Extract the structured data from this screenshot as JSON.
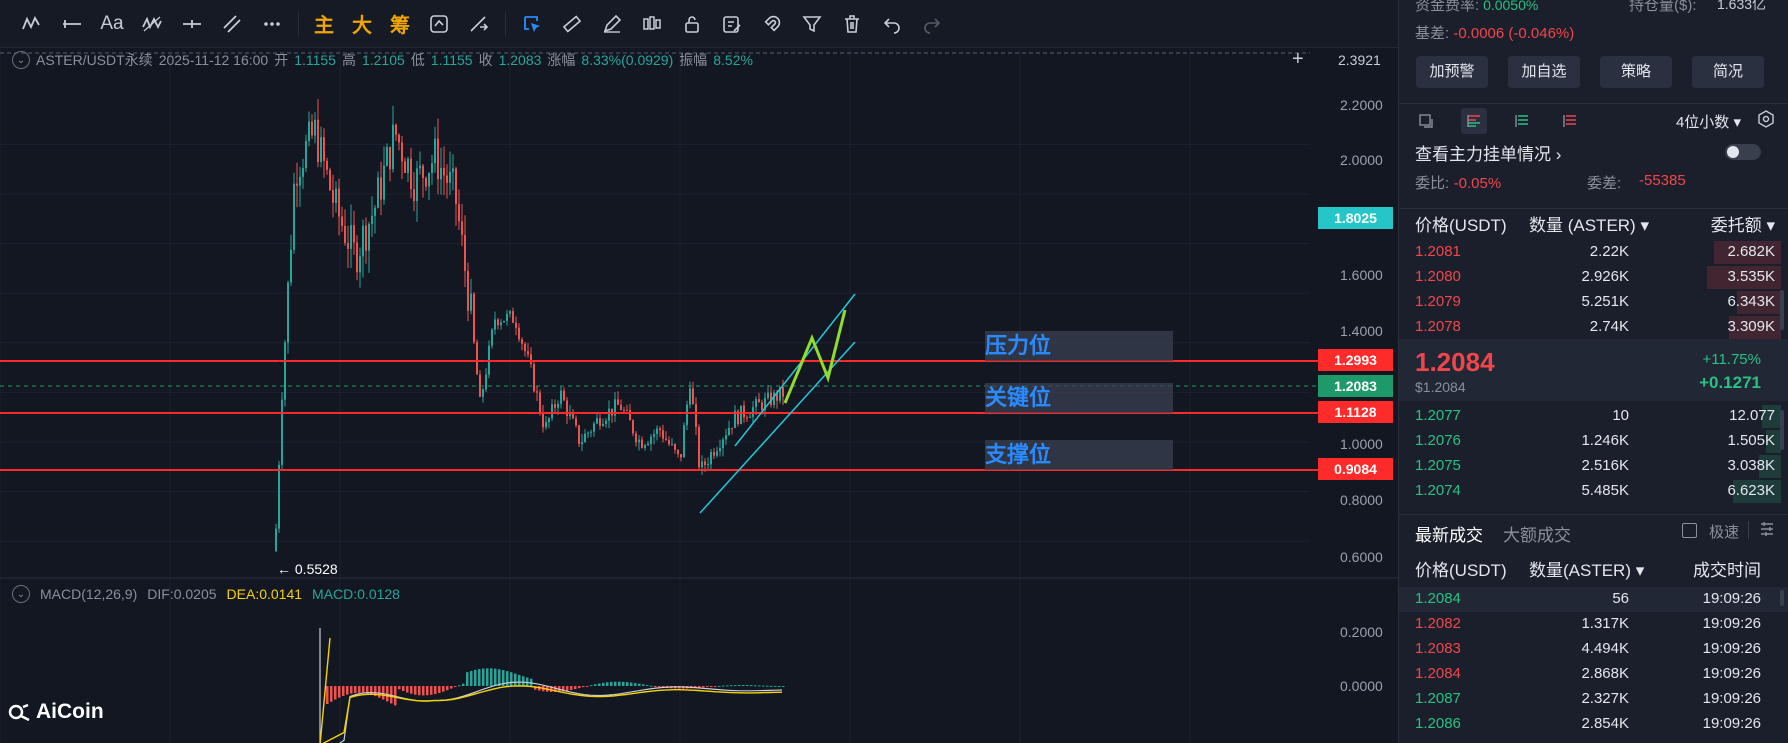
{
  "toolbar": {
    "text_items": [
      "主",
      "大",
      "筹"
    ],
    "font_label": "Aa"
  },
  "legend": {
    "pair": "ASTER/USDT永续",
    "time": "2025-11-12 16:00",
    "open_label": "开",
    "open": "1.1155",
    "high_label": "高",
    "high": "1.2105",
    "low_label": "低",
    "low": "1.1155",
    "close_label": "收",
    "close": "1.2083",
    "change_label": "涨幅",
    "change": "8.33%(0.0929)",
    "amp_label": "振幅",
    "amp": "8.52%"
  },
  "macd_legend": {
    "name": "MACD(12,26,9)",
    "dif": "DIF:0.0205",
    "dea": "DEA:0.0141",
    "macd": "MACD:0.0128"
  },
  "zones": {
    "resistance": "压力位",
    "key": "关键位",
    "support": "支撑位"
  },
  "price_tags": {
    "top": "2.3921",
    "highlight": "1.8025",
    "resistance": "1.2993",
    "current": "1.2083",
    "key": "1.1128",
    "support": "0.9084"
  },
  "axis_labels": [
    "2.2000",
    "2.0000",
    "1.6000",
    "1.4000",
    "1.0000",
    "0.8000",
    "0.6000"
  ],
  "macd_axis": [
    "0.2000",
    "0.0000"
  ],
  "low_marker": "0.5528",
  "logo": "AiCoin",
  "panel": {
    "funding_label": "资金费率:",
    "funding_value": "0.0050%",
    "oi_label": "持仓量($):",
    "oi_value": "1.633亿",
    "basis_label": "基差:",
    "basis_value": "-0.0006 (-0.046%)",
    "buttons": [
      "加预警",
      "加自选",
      "策略",
      "简况"
    ],
    "precision": "4位小数",
    "main_orders": "查看主力挂单情况",
    "ratio_label": "委比:",
    "ratio_value": "-0.05%",
    "diff_label": "委差:",
    "diff_value": "-55385",
    "ob_headers": [
      "价格(USDT)",
      "数量 (ASTER)",
      "委托额"
    ],
    "asks": [
      {
        "price": "1.2081",
        "qty": "2.22K",
        "amount": "2.682K",
        "depth": 0.18
      },
      {
        "price": "1.2080",
        "qty": "2.926K",
        "amount": "3.535K",
        "depth": 0.2
      },
      {
        "price": "1.2079",
        "qty": "5.251K",
        "amount": "6.343K",
        "depth": 0.12
      },
      {
        "price": "1.2078",
        "qty": "2.74K",
        "amount": "3.309K",
        "depth": 0.14
      }
    ],
    "last_price": "1.2084",
    "last_price_usd": "$1.2084",
    "last_change_pct": "+11.75%",
    "last_change_abs": "+0.1271",
    "bids": [
      {
        "price": "1.2077",
        "qty": "10",
        "amount": "12.077",
        "depth": 0.05
      },
      {
        "price": "1.2076",
        "qty": "1.246K",
        "amount": "1.505K",
        "depth": 0.04
      },
      {
        "price": "1.2075",
        "qty": "2.516K",
        "amount": "3.038K",
        "depth": 0.06
      },
      {
        "price": "1.2074",
        "qty": "5.485K",
        "amount": "6.623K",
        "depth": 0.13
      }
    ],
    "trade_tabs": [
      "最新成交",
      "大额成交"
    ],
    "fast_label": "极速",
    "trade_headers": [
      "价格(USDT)",
      "数量(ASTER)",
      "成交时间"
    ],
    "trades": [
      {
        "price": "1.2084",
        "qty": "56",
        "time": "19:09:26",
        "side": "buy"
      },
      {
        "price": "1.2082",
        "qty": "1.317K",
        "time": "19:09:26",
        "side": "sell"
      },
      {
        "price": "1.2083",
        "qty": "4.494K",
        "time": "19:09:26",
        "side": "sell"
      },
      {
        "price": "1.2084",
        "qty": "2.868K",
        "time": "19:09:26",
        "side": "sell"
      },
      {
        "price": "1.2087",
        "qty": "2.327K",
        "time": "19:09:26",
        "side": "buy"
      },
      {
        "price": "1.2086",
        "qty": "2.854K",
        "time": "19:09:26",
        "side": "buy"
      }
    ]
  },
  "colors": {
    "up": "#26a69a",
    "down": "#ef5350",
    "level_line": "#ff2a2a",
    "channel": "#22c8d8",
    "projection": "#8fdc2c",
    "zone_text": "#2a8bff"
  }
}
